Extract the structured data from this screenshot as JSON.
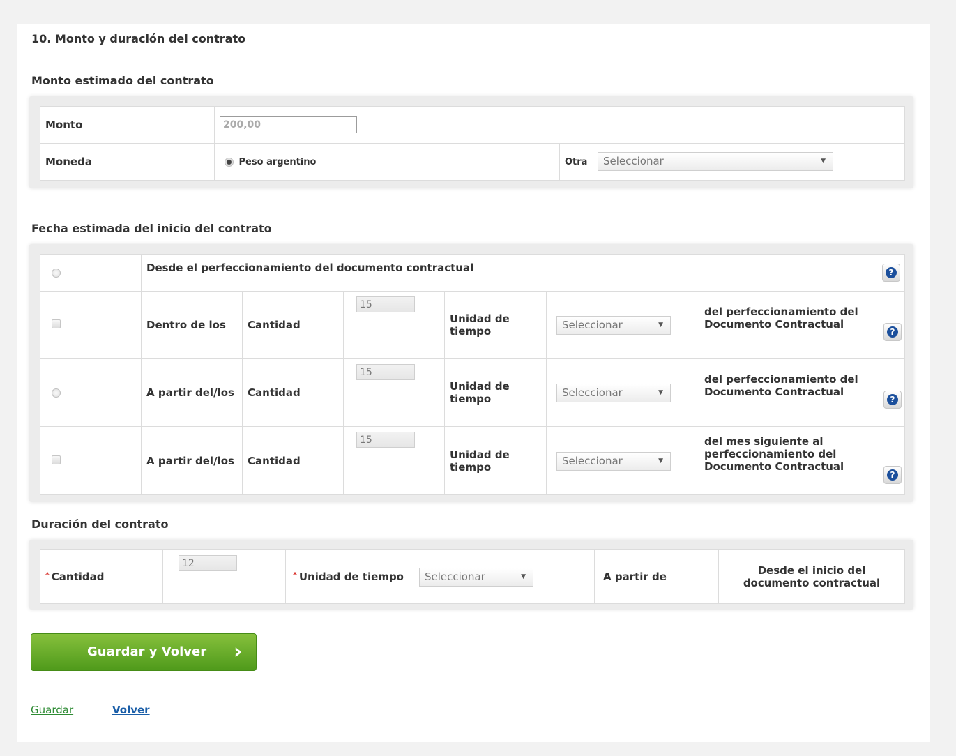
{
  "section_title": "10. Monto y duración del contrato",
  "monto_section": {
    "title": "Monto estimado del contrato",
    "monto_label": "Monto",
    "monto_placeholder": "200,00",
    "moneda_label": "Moneda",
    "moneda_option": "Peso argentino",
    "otra_label": "Otra",
    "otra_select": "Seleccionar"
  },
  "fecha_section": {
    "title": "Fecha estimada del inicio del contrato",
    "row1_text": "Desde el perfeccionamiento del documento contractual",
    "rows": [
      {
        "prefix": "Dentro de los",
        "cantidad_label": "Cantidad",
        "cantidad_value": "15",
        "unidad_label": "Unidad de tiempo",
        "select": "Seleccionar",
        "suffix": "del perfeccionamiento del Documento Contractual"
      },
      {
        "prefix": "A partir del/los",
        "cantidad_label": "Cantidad",
        "cantidad_value": "15",
        "unidad_label": "Unidad de tiempo",
        "select": "Seleccionar",
        "suffix": "del perfeccionamiento del Documento Contractual"
      },
      {
        "prefix": "A partir del/los",
        "cantidad_label": "Cantidad",
        "cantidad_value": "15",
        "unidad_label": "Unidad de tiempo",
        "select": "Seleccionar",
        "suffix": "del mes siguiente al perfeccionamiento del Documento Contractual"
      }
    ]
  },
  "duracion_section": {
    "title": "Duración del contrato",
    "required_mark": "*",
    "cantidad_label": "Cantidad",
    "cantidad_value": "12",
    "unidad_label": "Unidad de tiempo",
    "unidad_select": "Seleccionar",
    "apartir_label": "A partir de",
    "apartir_value": "Desde el inicio del documento contractual"
  },
  "actions": {
    "primary_button": "Guardar y Volver",
    "save_link": "Guardar",
    "back_link": "Volver"
  },
  "colors": {
    "primary_green": "#5ea727",
    "link_green": "#2e8b34",
    "link_blue": "#1a5ea8",
    "help_blue": "#1b4f9c",
    "required_red": "#d9322d"
  }
}
